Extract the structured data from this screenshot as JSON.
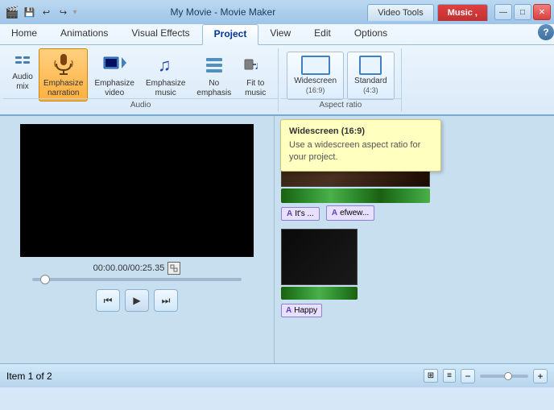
{
  "titleBar": {
    "title": "My Movie - Movie Maker",
    "quickAccess": [
      "💾",
      "↩",
      "↪"
    ],
    "controls": [
      "—",
      "□",
      "✕"
    ]
  },
  "topTabs": [
    {
      "id": "video-tools",
      "label": "Video Tools",
      "active": false
    },
    {
      "id": "music",
      "label": "Music ,",
      "active": true
    }
  ],
  "ribbonTabs": [
    {
      "id": "home",
      "label": "Home",
      "active": false
    },
    {
      "id": "animations",
      "label": "Animations",
      "active": false
    },
    {
      "id": "visual-effects",
      "label": "Visual Effects",
      "active": false
    },
    {
      "id": "project",
      "label": "Project",
      "active": true
    },
    {
      "id": "view",
      "label": "View",
      "active": false
    },
    {
      "id": "edit",
      "label": "Edit",
      "active": false
    },
    {
      "id": "options",
      "label": "Options",
      "active": false
    }
  ],
  "audioGroup": {
    "label": "Audio",
    "buttons": [
      {
        "id": "audio-mix",
        "label": "Audio\nmix",
        "icon": "audio-mix-icon"
      },
      {
        "id": "emphasize-narration",
        "label": "Emphasize\nnarration",
        "icon": "mic-icon",
        "active": true
      },
      {
        "id": "emphasize-video",
        "label": "Emphasize\nvideo",
        "icon": "video-icon"
      },
      {
        "id": "emphasize-music",
        "label": "Emphasize\nmusic",
        "icon": "music-icon"
      },
      {
        "id": "no-emphasis",
        "label": "No\nemphasis",
        "icon": "no-emphasis-icon"
      },
      {
        "id": "fit-to-music",
        "label": "Fit to\nmusic",
        "icon": "fit-music-icon"
      }
    ]
  },
  "aspectRatioGroup": {
    "label": "Aspect ratio",
    "buttons": [
      {
        "id": "widescreen",
        "label": "Widescreen",
        "sublabel": "(16:9)"
      },
      {
        "id": "standard",
        "label": "Standard",
        "sublabel": "(4:3)"
      }
    ]
  },
  "tooltip": {
    "title": "Widescreen (16:9)",
    "body": "Use a widescreen aspect ratio for your project."
  },
  "preview": {
    "time": "00:00.00/00:25.35",
    "controls": [
      "⏮",
      "▶",
      "⏭"
    ]
  },
  "timeline": {
    "clips": [
      {
        "labels": [
          "It's ...",
          "efwew..."
        ]
      },
      {
        "labels": [
          "Happy"
        ]
      }
    ]
  },
  "statusBar": {
    "text": "Item 1 of 2"
  }
}
